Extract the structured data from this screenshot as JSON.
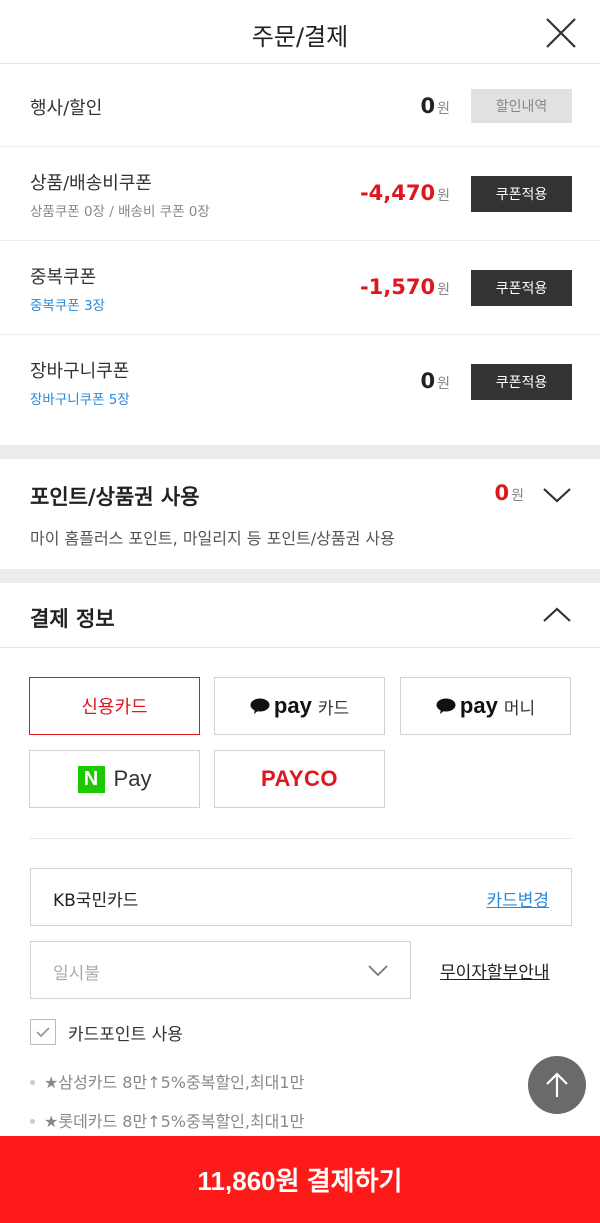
{
  "header": {
    "title": "주문/결제",
    "close_icon": "close-icon"
  },
  "discounts": [
    {
      "label": "행사/할인",
      "sub": "",
      "amount": "0",
      "unit": "원",
      "amount_color": "#222222",
      "button": "할인내역",
      "button_style": "disabled"
    },
    {
      "label": "상품/배송비쿠폰",
      "sub": "상품쿠폰 0장 / 배송비 쿠폰 0장",
      "amount": "-4,470",
      "unit": "원",
      "amount_color": "#e0161e",
      "button": "쿠폰적용",
      "button_style": "dark"
    },
    {
      "label": "중복쿠폰",
      "sub": "중복쿠폰 3장",
      "amount": "-1,570",
      "unit": "원",
      "amount_color": "#e0161e",
      "button": "쿠폰적용",
      "button_style": "dark"
    },
    {
      "label": "장바구니쿠폰",
      "sub": "장바구니쿠폰 5장",
      "amount": "0",
      "unit": "원",
      "amount_color": "#222222",
      "button": "쿠폰적용",
      "button_style": "dark"
    }
  ],
  "points": {
    "title": "포인트/상품권 사용",
    "amount": "0",
    "unit": "원",
    "description": "마이 홈플러스 포인트, 마일리지 등 포인트/상품권 사용",
    "chevron_icon": "chevron-down-icon"
  },
  "payment_info": {
    "title": "결제 정보",
    "chevron_icon": "chevron-up-icon",
    "methods": {
      "credit_card": "신용카드",
      "kakaopay_card": {
        "brand": "pay",
        "suffix": "카드"
      },
      "kakaopay_money": {
        "brand": "pay",
        "suffix": "머니"
      },
      "npay": {
        "mark": "N",
        "text": "Pay"
      },
      "payco": "PAYCO"
    },
    "selected_method": "신용카드",
    "card": {
      "name": "KB국민카드",
      "change_label": "카드변경"
    },
    "installment": {
      "value": "일시불",
      "interest_free_link": "무이자할부안내"
    },
    "card_point": {
      "label": "카드포인트 사용",
      "checked": true
    },
    "promotions": [
      "★삼성카드 8만↑5%중복할인,최대1만",
      "★롯데카드 8만↑5%중복할인,최대1만"
    ]
  },
  "footer": {
    "pay_button": "11,860원 결제하기"
  },
  "colors": {
    "accent_red": "#ff1a1a",
    "price_red": "#e0161e",
    "link_blue": "#2b8ad8",
    "npay_green": "#1ec800"
  }
}
